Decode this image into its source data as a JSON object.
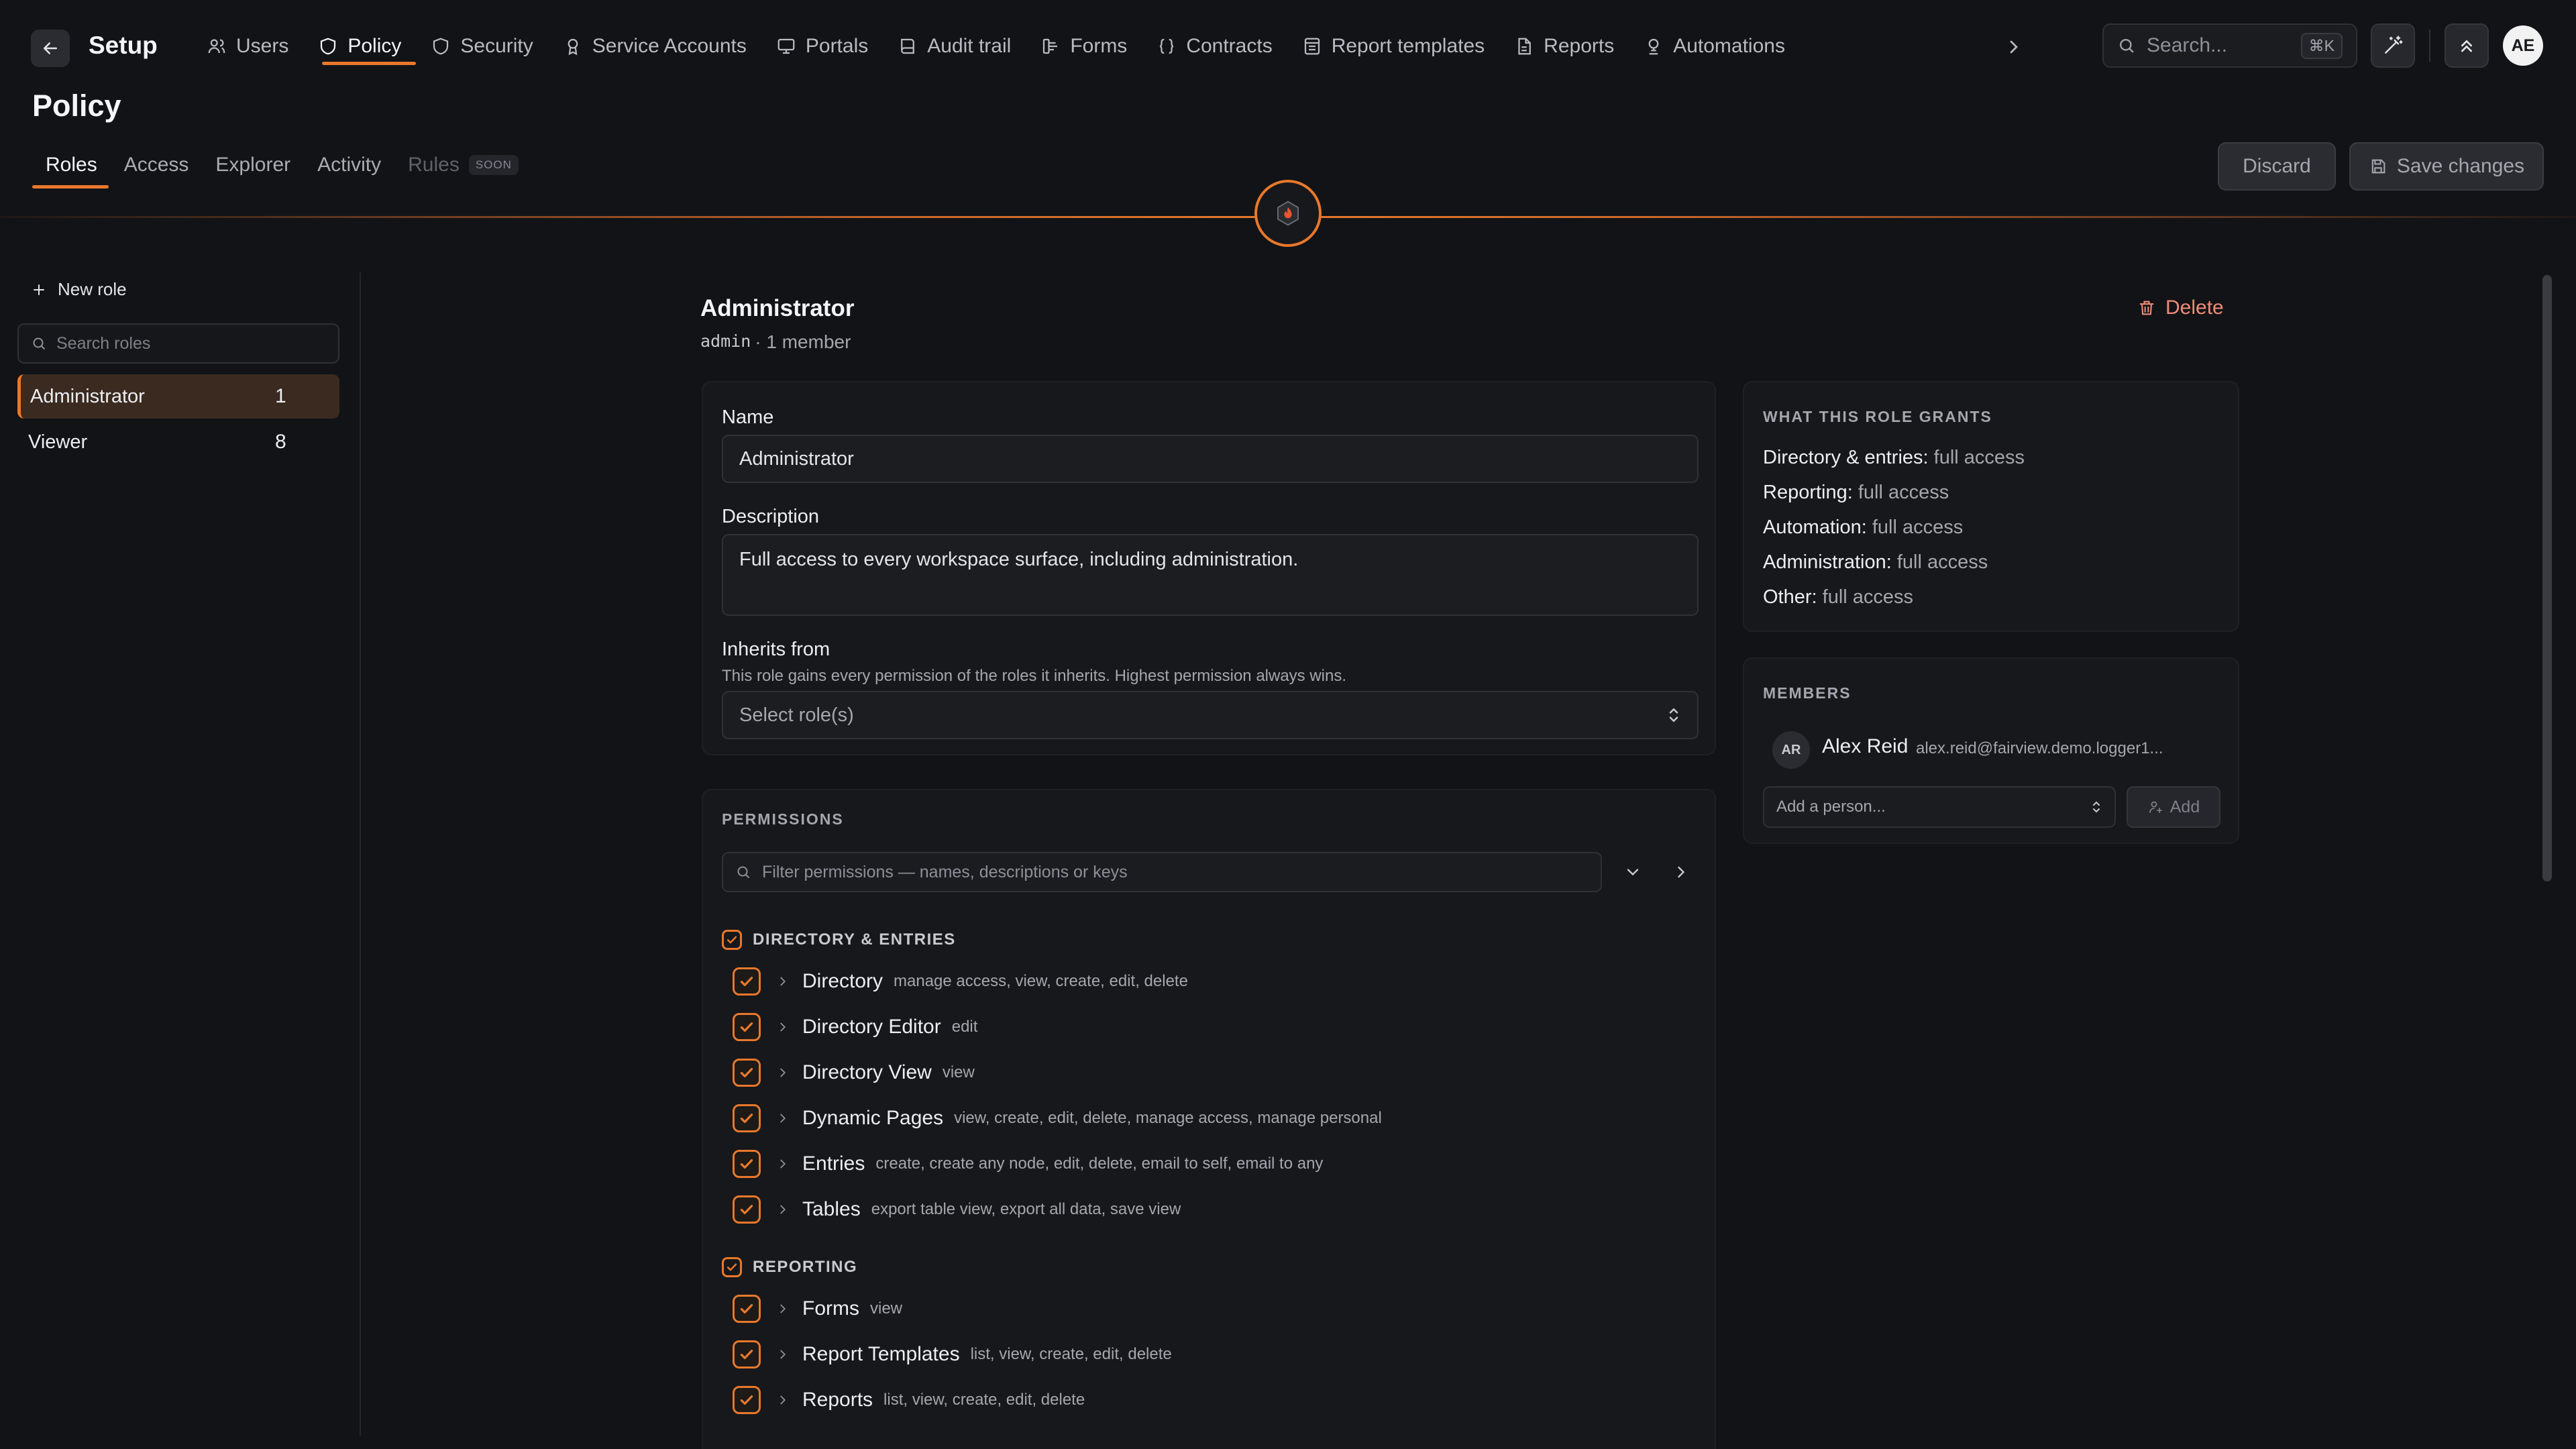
{
  "app": {
    "title": "Setup",
    "user_initials": "AE"
  },
  "nav": {
    "tabs": [
      {
        "label": "Users",
        "icon": "users-icon"
      },
      {
        "label": "Policy",
        "icon": "shield-icon"
      },
      {
        "label": "Security",
        "icon": "shield-icon"
      },
      {
        "label": "Service Accounts",
        "icon": "badge-icon"
      },
      {
        "label": "Portals",
        "icon": "monitor-icon"
      },
      {
        "label": "Audit trail",
        "icon": "book-icon"
      },
      {
        "label": "Forms",
        "icon": "form-icon"
      },
      {
        "label": "Contracts",
        "icon": "braces-icon"
      },
      {
        "label": "Report templates",
        "icon": "template-icon"
      },
      {
        "label": "Reports",
        "icon": "file-icon"
      },
      {
        "label": "Automations",
        "icon": "bot-icon"
      }
    ],
    "active_tab": "Policy"
  },
  "search": {
    "placeholder": "Search...",
    "shortcut": "⌘K"
  },
  "page": {
    "title": "Policy",
    "subtabs": [
      {
        "label": "Roles"
      },
      {
        "label": "Access"
      },
      {
        "label": "Explorer"
      },
      {
        "label": "Activity"
      },
      {
        "label": "Rules",
        "badge": "SOON"
      }
    ],
    "discard_label": "Discard",
    "save_label": "Save changes"
  },
  "sidebar": {
    "new_role_label": "New role",
    "search_placeholder": "Search roles",
    "roles": [
      {
        "name": "Administrator",
        "count": "1",
        "active": true
      },
      {
        "name": "Viewer",
        "count": "8",
        "active": false
      }
    ]
  },
  "role": {
    "name": "Administrator",
    "key": "admin",
    "member_summary": "· 1 member",
    "delete_label": "Delete",
    "name_label": "Name",
    "name_value": "Administrator",
    "description_label": "Description",
    "description_value": "Full access to every workspace surface, including administration.",
    "inherits_label": "Inherits from",
    "inherits_hint": "This role gains every permission of the roles it inherits. Highest permission always wins.",
    "inherits_placeholder": "Select role(s)"
  },
  "permissions": {
    "caption": "PERMISSIONS",
    "filter_placeholder": "Filter permissions — names, descriptions or keys",
    "groups": [
      {
        "name": "DIRECTORY & ENTRIES",
        "items": [
          {
            "name": "Directory",
            "desc": "manage access, view, create, edit, delete"
          },
          {
            "name": "Directory Editor",
            "desc": "edit"
          },
          {
            "name": "Directory View",
            "desc": "view"
          },
          {
            "name": "Dynamic Pages",
            "desc": "view, create, edit, delete, manage access, manage personal"
          },
          {
            "name": "Entries",
            "desc": "create, create any node, edit, delete, email to self, email to any"
          },
          {
            "name": "Tables",
            "desc": "export table view, export all data, save view"
          }
        ]
      },
      {
        "name": "REPORTING",
        "items": [
          {
            "name": "Forms",
            "desc": "view"
          },
          {
            "name": "Report Templates",
            "desc": "list, view, create, edit, delete"
          },
          {
            "name": "Reports",
            "desc": "list, view, create, edit, delete"
          }
        ]
      }
    ]
  },
  "grants": {
    "caption": "WHAT THIS ROLE GRANTS",
    "items": [
      {
        "area": "Directory & entries:",
        "level": "full access"
      },
      {
        "area": "Reporting:",
        "level": "full access"
      },
      {
        "area": "Automation:",
        "level": "full access"
      },
      {
        "area": "Administration:",
        "level": "full access"
      },
      {
        "area": "Other:",
        "level": "full access"
      }
    ]
  },
  "members": {
    "caption": "MEMBERS",
    "list": [
      {
        "initials": "AR",
        "name": "Alex Reid",
        "email": "alex.reid@fairview.demo.logger1..."
      }
    ],
    "add_placeholder": "Add a person...",
    "add_label": "Add"
  },
  "colors": {
    "accent": "#e8782c",
    "danger": "#f08c78",
    "background": "#121316"
  }
}
